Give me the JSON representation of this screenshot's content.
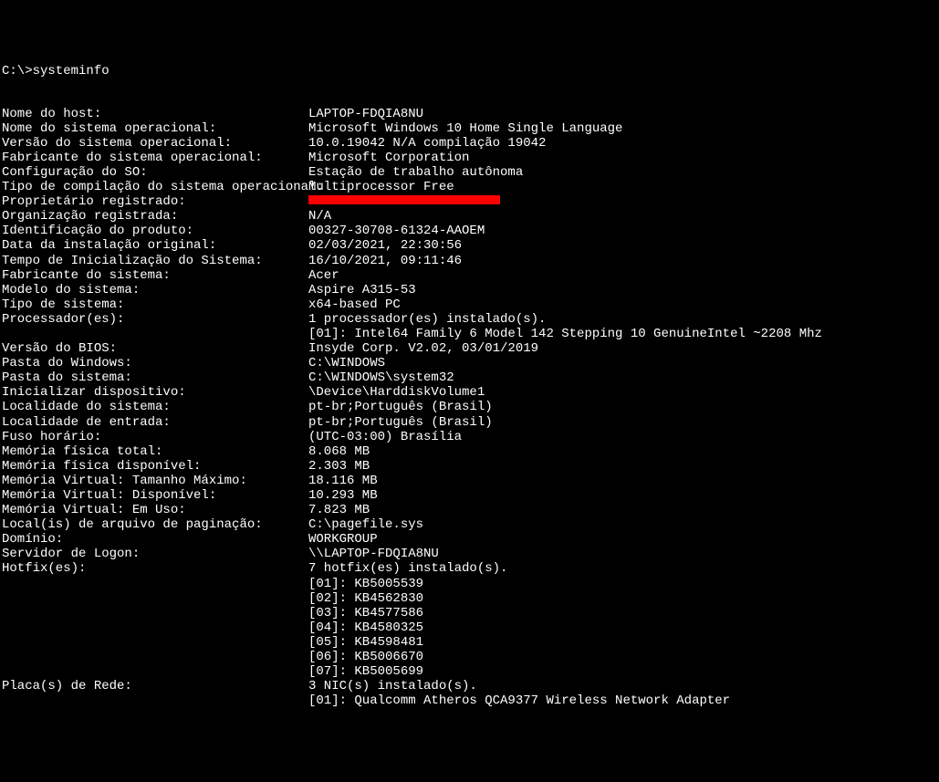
{
  "prompt": "C:\\>systeminfo",
  "rows": [
    {
      "label": "Nome do host:",
      "value": "LAPTOP-FDQIA8NU"
    },
    {
      "label": "Nome do sistema operacional:",
      "value": "Microsoft Windows 10 Home Single Language"
    },
    {
      "label": "Versão do sistema operacional:",
      "value": "10.0.19042 N/A compilação 19042"
    },
    {
      "label": "Fabricante do sistema operacional:",
      "value": "Microsoft Corporation"
    },
    {
      "label": "Configuração do SO:",
      "value": "Estação de trabalho autônoma"
    },
    {
      "label": "Tipo de compilação do sistema operacional:",
      "value": "Multiprocessor Free"
    },
    {
      "label": "Proprietário registrado:",
      "value": "",
      "redacted": true
    },
    {
      "label": "Organização registrada:",
      "value": "N/A"
    },
    {
      "label": "Identificação do produto:",
      "value": "00327-30708-61324-AAOEM"
    },
    {
      "label": "Data da instalação original:",
      "value": "02/03/2021, 22:30:56"
    },
    {
      "label": "Tempo de Inicialização do Sistema:",
      "value": "16/10/2021, 09:11:46"
    },
    {
      "label": "Fabricante do sistema:",
      "value": "Acer"
    },
    {
      "label": "Modelo do sistema:",
      "value": "Aspire A315-53"
    },
    {
      "label": "Tipo de sistema:",
      "value": "x64-based PC"
    },
    {
      "label": "Processador(es):",
      "value": "1 processador(es) instalado(s)."
    },
    {
      "label": "",
      "value": "[01]: Intel64 Family 6 Model 142 Stepping 10 GenuineIntel ~2208 Mhz"
    },
    {
      "label": "Versão do BIOS:",
      "value": "Insyde Corp. V2.02, 03/01/2019"
    },
    {
      "label": "Pasta do Windows:",
      "value": "C:\\WINDOWS"
    },
    {
      "label": "Pasta do sistema:",
      "value": "C:\\WINDOWS\\system32"
    },
    {
      "label": "Inicializar dispositivo:",
      "value": "\\Device\\HarddiskVolume1"
    },
    {
      "label": "Localidade do sistema:",
      "value": "pt-br;Português (Brasil)"
    },
    {
      "label": "Localidade de entrada:",
      "value": "pt-br;Português (Brasil)"
    },
    {
      "label": "Fuso horário:",
      "value": "(UTC-03:00) Brasília"
    },
    {
      "label": "Memória física total:",
      "value": "8.068 MB"
    },
    {
      "label": "Memória física disponível:",
      "value": "2.303 MB"
    },
    {
      "label": "Memória Virtual: Tamanho Máximo:",
      "value": "18.116 MB"
    },
    {
      "label": "Memória Virtual: Disponível:",
      "value": "10.293 MB"
    },
    {
      "label": "Memória Virtual: Em Uso:",
      "value": "7.823 MB"
    },
    {
      "label": "Local(is) de arquivo de paginação:",
      "value": "C:\\pagefile.sys"
    },
    {
      "label": "Domínio:",
      "value": "WORKGROUP"
    },
    {
      "label": "Servidor de Logon:",
      "value": "\\\\LAPTOP-FDQIA8NU"
    },
    {
      "label": "Hotfix(es):",
      "value": "7 hotfix(es) instalado(s)."
    },
    {
      "label": "",
      "value": "[01]: KB5005539"
    },
    {
      "label": "",
      "value": "[02]: KB4562830"
    },
    {
      "label": "",
      "value": "[03]: KB4577586"
    },
    {
      "label": "",
      "value": "[04]: KB4580325"
    },
    {
      "label": "",
      "value": "[05]: KB4598481"
    },
    {
      "label": "",
      "value": "[06]: KB5006670"
    },
    {
      "label": "",
      "value": "[07]: KB5005699"
    },
    {
      "label": "Placa(s) de Rede:",
      "value": "3 NIC(s) instalado(s)."
    },
    {
      "label": "",
      "value": "[01]: Qualcomm Atheros QCA9377 Wireless Network Adapter"
    }
  ]
}
